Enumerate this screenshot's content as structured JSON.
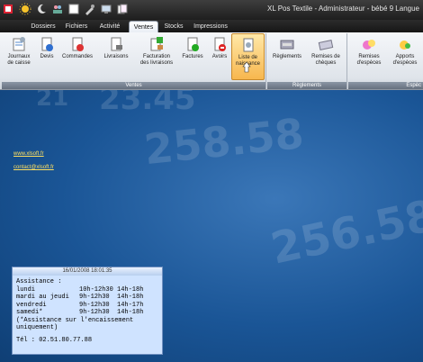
{
  "window": {
    "title": "XL Pos Textile - Administrateur - bébé 9 Langue"
  },
  "qat": [
    "app-icon",
    "sun-icon",
    "moon-icon",
    "people-icon",
    "preview-icon",
    "tools-icon",
    "network-icon",
    "cards-icon"
  ],
  "tabs": [
    "Dossiers",
    "Fichiers",
    "Activité",
    "Ventes",
    "Stocks",
    "Impressions"
  ],
  "active_tab": "Ventes",
  "ribbon": {
    "groups": [
      "Ventes",
      "Règlements",
      "Espèc"
    ],
    "buttons": [
      {
        "l1": "Journaux",
        "l2": "de caisse",
        "icon": "journal-icon"
      },
      {
        "l1": "Devis",
        "l2": "",
        "icon": "devis-icon"
      },
      {
        "l1": "Commandes",
        "l2": "",
        "icon": "commandes-icon"
      },
      {
        "l1": "Livraisons",
        "l2": "",
        "icon": "livraisons-icon"
      },
      {
        "l1": "Facturation",
        "l2": "des livraisons",
        "icon": "facturation-icon"
      },
      {
        "l1": "Factures",
        "l2": "",
        "icon": "factures-icon"
      },
      {
        "l1": "Avoirs",
        "l2": "",
        "icon": "avoirs-icon"
      },
      {
        "l1": "Liste de",
        "l2": "naissance",
        "icon": "liste-naissance-icon"
      },
      {
        "l1": "Règlements",
        "l2": "",
        "icon": "reglements-icon"
      },
      {
        "l1": "Remises de",
        "l2": "chèques",
        "icon": "remises-cheques-icon"
      },
      {
        "l1": "Remises",
        "l2": "d'espèces",
        "icon": "remises-especes-icon"
      },
      {
        "l1": "Apports",
        "l2": "d'espèces",
        "icon": "apports-especes-icon"
      }
    ]
  },
  "links": [
    "www.xlsoft.fr",
    "contact@xlsoft.fr"
  ],
  "bg_numbers": [
    "21",
    "23.45",
    "258.58",
    "256.58"
  ],
  "assistance": {
    "datetime": "16/01/2008 18:01:35",
    "title": "Assistance :",
    "rows": [
      [
        "lundi",
        "10h-12h30",
        "14h-18h"
      ],
      [
        "mardi au jeudi",
        "9h-12h30",
        "14h-18h"
      ],
      [
        "vendredi",
        "9h-12h30",
        "14h-17h"
      ],
      [
        "samedi*",
        "9h-12h30",
        "14h-18h"
      ]
    ],
    "note1": "(*Assistance sur l'encaissement",
    "note2": "uniquement)",
    "phone": "Tél : 02.51.80.77.88"
  },
  "colors": {
    "accent": "#f7b74e",
    "link": "#ffe060",
    "panel": "#cfe3ff"
  }
}
